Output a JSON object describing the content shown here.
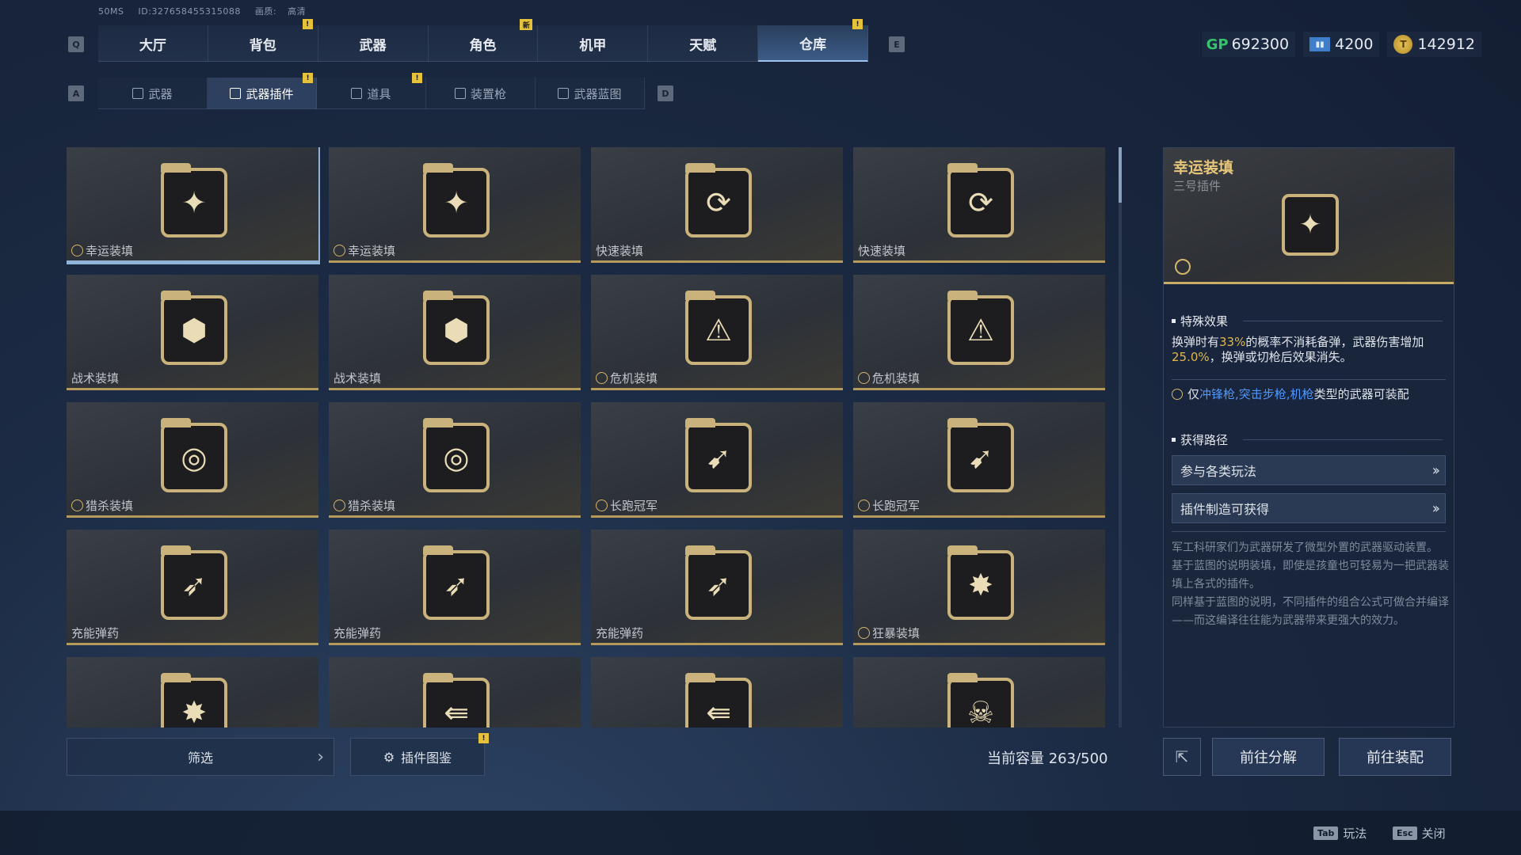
{
  "status": {
    "ping": "50MS",
    "id": "ID:327658455315088",
    "quality_label": "画质:",
    "quality_value": "高清"
  },
  "main_tabs": {
    "prev_key": "Q",
    "next_key": "E",
    "items": [
      {
        "label": "大厅"
      },
      {
        "label": "背包",
        "badge": "!"
      },
      {
        "label": "武器"
      },
      {
        "label": "角色",
        "badge": "新"
      },
      {
        "label": "机甲"
      },
      {
        "label": "天赋"
      },
      {
        "label": "仓库",
        "badge": "!",
        "active": true
      }
    ]
  },
  "currencies": [
    {
      "icon": "gp-currency-icon",
      "symbol": "GP",
      "value": "692300"
    },
    {
      "icon": "ticket-icon",
      "symbol": "",
      "value": "4200"
    },
    {
      "icon": "gold-coin-icon",
      "symbol": "",
      "value": "142912"
    }
  ],
  "sub_tabs": {
    "prev_key": "A",
    "next_key": "D",
    "items": [
      {
        "label": "武器",
        "icon": "rifle-icon"
      },
      {
        "label": "武器插件",
        "icon": "plugin-chip-icon",
        "badge": "!",
        "active": true
      },
      {
        "label": "道具",
        "icon": "item-icon",
        "badge": "!"
      },
      {
        "label": "装置枪",
        "icon": "device-gun-icon"
      },
      {
        "label": "武器蓝图",
        "icon": "blueprint-icon"
      }
    ]
  },
  "plugins": [
    {
      "name": "幸运装填",
      "glyph": "✦",
      "icon": "winged-bullet-icon",
      "gear": true,
      "selected": true
    },
    {
      "name": "幸运装填",
      "glyph": "✦",
      "icon": "winged-bullet-icon",
      "gear": true
    },
    {
      "name": "快速装填",
      "glyph": "⟳",
      "icon": "fast-reload-icon",
      "gear": false
    },
    {
      "name": "快速装填",
      "glyph": "⟳",
      "icon": "fast-reload-icon",
      "gear": false
    },
    {
      "name": "战术装填",
      "glyph": "⬢",
      "icon": "tactical-head-icon",
      "gear": false
    },
    {
      "name": "战术装填",
      "glyph": "⬢",
      "icon": "tactical-head-icon",
      "gear": false
    },
    {
      "name": "危机装填",
      "glyph": "⚠",
      "icon": "crisis-ammo-icon",
      "gear": true
    },
    {
      "name": "危机装填",
      "glyph": "⚠",
      "icon": "crisis-ammo-icon",
      "gear": true
    },
    {
      "name": "猎杀装填",
      "glyph": "◎",
      "icon": "crosshair-ammo-icon",
      "gear": true
    },
    {
      "name": "猎杀装填",
      "glyph": "◎",
      "icon": "crosshair-ammo-icon",
      "gear": true
    },
    {
      "name": "长跑冠军",
      "glyph": "➹",
      "icon": "runner-ammo-icon",
      "gear": true
    },
    {
      "name": "长跑冠军",
      "glyph": "➹",
      "icon": "runner-ammo-icon",
      "gear": true
    },
    {
      "name": "充能弹药",
      "glyph": "➶",
      "icon": "charged-bullet-icon",
      "gear": false
    },
    {
      "name": "充能弹药",
      "glyph": "➶",
      "icon": "charged-bullet-icon",
      "gear": false
    },
    {
      "name": "充能弹药",
      "glyph": "➶",
      "icon": "charged-bullet-icon",
      "gear": false
    },
    {
      "name": "狂暴装填",
      "glyph": "✸",
      "icon": "berserk-gun-icon",
      "gear": true
    },
    {
      "name": "",
      "glyph": "✸",
      "icon": "gun-plugin-icon",
      "gear": false
    },
    {
      "name": "",
      "glyph": "⇚",
      "icon": "arrow-gun-icon",
      "gear": false
    },
    {
      "name": "",
      "glyph": "⇚",
      "icon": "arrow-gun-icon",
      "gear": false
    },
    {
      "name": "",
      "glyph": "☠",
      "icon": "skull-target-icon",
      "gear": false
    }
  ],
  "bottom": {
    "filter_label": "筛选",
    "codex_label": "插件图鉴",
    "codex_badge": "!",
    "capacity_label": "当前容量",
    "capacity_value": "263/500"
  },
  "detail": {
    "title": "幸运装填",
    "subtitle": "三号插件",
    "special_title": "特殊效果",
    "effect_pre": "换弹时有",
    "effect_pct1": "33%",
    "effect_mid": "的概率不消耗备弹，武器伤害增加",
    "effect_pct2": "25.0%",
    "effect_post": "，换弹或切枪后效果消失。",
    "equip_pre": "仅",
    "equip_types": "冲锋枪,突击步枪,机枪",
    "equip_post": "类型的武器可装配",
    "source_title": "获得路径",
    "sources": [
      "参与各类玩法",
      "插件制造可获得"
    ],
    "lore": [
      "军工科研家们为武器研发了微型外置的武器驱动装置。",
      "基于蓝图的说明装填，即使是孩童也可轻易为一把武器装填上各式的插件。",
      "同样基于蓝图的说明，不同插件的组合公式可做合并编译——而这编译往往能为武器带来更强大的效力。"
    ]
  },
  "actions": {
    "disassemble": "前往分解",
    "equip": "前往装配"
  },
  "footer": {
    "hints": [
      {
        "key": "Tab",
        "label": "玩法"
      },
      {
        "key": "Esc",
        "label": "关闭"
      }
    ]
  }
}
